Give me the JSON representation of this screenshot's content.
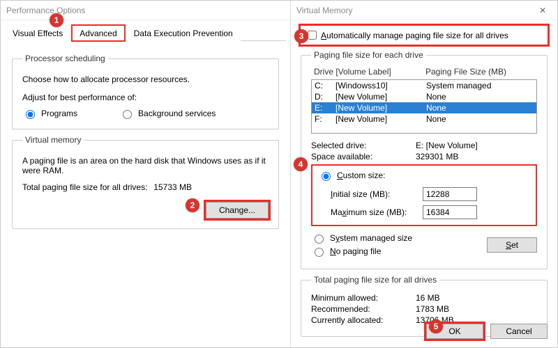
{
  "perf": {
    "title": "Performance Options",
    "tabs": {
      "visual": "Visual Effects",
      "advanced": "Advanced",
      "dep": "Data Execution Prevention"
    },
    "sched_legend": "Processor scheduling",
    "sched_text": "Choose how to allocate processor resources.",
    "adjust_label": "Adjust for best performance of:",
    "programs": "Programs",
    "bg": "Background services",
    "vm_legend": "Virtual memory",
    "vm_text": "A paging file is an area on the hard disk that Windows uses as if it were RAM.",
    "total_label": "Total paging file size for all drives:",
    "total_value": "15733 MB",
    "change_btn": "Change..."
  },
  "vm": {
    "title": "Virtual Memory",
    "auto_manage": "Automatically manage paging file size for all drives",
    "group_drives": "Paging file size for each drive",
    "header_drive": "Drive  [Volume Label]",
    "header_size": "Paging File Size (MB)",
    "drives": [
      {
        "d": "C:",
        "v": "[Windowss10]",
        "s": "System managed"
      },
      {
        "d": "D:",
        "v": "[New Volume]",
        "s": "None"
      },
      {
        "d": "E:",
        "v": "[New Volume]",
        "s": "None"
      },
      {
        "d": "F:",
        "v": "[New Volume]",
        "s": "None"
      }
    ],
    "sel_drive_k": "Selected drive:",
    "sel_drive_v": "E:  [New Volume]",
    "sel_space_k": "Space available:",
    "sel_space_v": "329301 MB",
    "custom": "Custom size:",
    "init_k": "Initial size (MB):",
    "init_v": "12288",
    "max_k": "Maximum size (MB):",
    "max_v": "16384",
    "sysman": "System managed size",
    "nopag": "No paging file",
    "set_btn": "Set",
    "totals_legend": "Total paging file size for all drives",
    "min_k": "Minimum allowed:",
    "min_v": "16 MB",
    "rec_k": "Recommended:",
    "rec_v": "1783 MB",
    "cur_k": "Currently allocated:",
    "cur_v": "13706 MB",
    "ok_btn": "OK",
    "cancel_btn": "Cancel"
  },
  "markers": {
    "m1": "1",
    "m2": "2",
    "m3": "3",
    "m4": "4",
    "m5": "5"
  }
}
